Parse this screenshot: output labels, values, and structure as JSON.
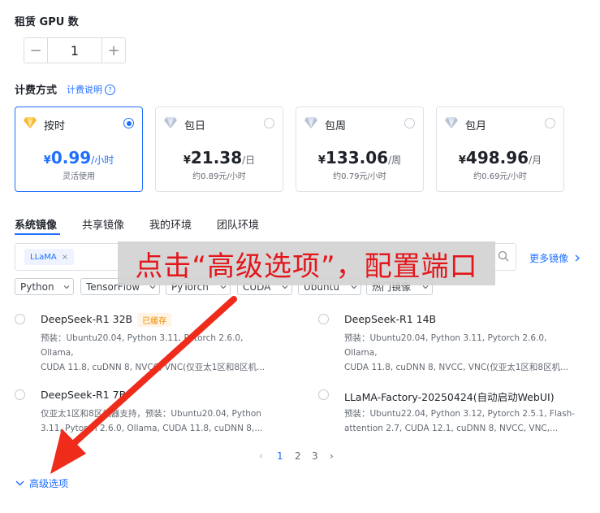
{
  "gpu": {
    "title": "租赁 GPU 数",
    "value": "1",
    "minus": "−",
    "plus": "+"
  },
  "billing": {
    "title": "计费方式",
    "help_link": "计费说明",
    "help_icon": "?",
    "plans": [
      {
        "name": "按时",
        "currency": "¥",
        "amount": "0.99",
        "unit": "/小时",
        "sub": "灵活使用",
        "selected": true,
        "icon": "gold-diamond-icon"
      },
      {
        "name": "包日",
        "currency": "¥",
        "amount": "21.38",
        "unit": "/日",
        "sub": "约0.89元/小时",
        "selected": false,
        "icon": "silver-diamond-icon"
      },
      {
        "name": "包周",
        "currency": "¥",
        "amount": "133.06",
        "unit": "/周",
        "sub": "约0.79元/小时",
        "selected": false,
        "icon": "silver-diamond-icon"
      },
      {
        "name": "包月",
        "currency": "¥",
        "amount": "498.96",
        "unit": "/月",
        "sub": "约0.69元/小时",
        "selected": false,
        "icon": "silver-diamond-icon"
      }
    ]
  },
  "tabs": [
    "系统镜像",
    "共享镜像",
    "我的环境",
    "团队环境"
  ],
  "search": {
    "chip": "LLaMA",
    "chip_close": "×",
    "more": "更多镜像"
  },
  "filters": [
    "Python",
    "TensorFlow",
    "PyTorch",
    "CUDA",
    "Ubuntu",
    "热门镜像"
  ],
  "images": [
    {
      "title": "DeepSeek-R1 32B",
      "badge": "已缓存",
      "desc1": "预装：Ubuntu20.04, Python 3.11, Pytorch 2.6.0, Ollama,",
      "desc2": "CUDA 11.8, cuDNN 8, NVCC, VNC(仅亚太1区和8区机..."
    },
    {
      "title": "DeepSeek-R1 14B",
      "badge": "",
      "desc1": "预装：Ubuntu20.04, Python 3.11, Pytorch 2.6.0, Ollama,",
      "desc2": "CUDA 11.8, cuDNN 8, NVCC, VNC(仅亚太1区和8区机..."
    },
    {
      "title": "DeepSeek-R1 7B",
      "badge": "",
      "desc1": "仅亚太1区和8区机器支持，预装：Ubuntu20.04, Python",
      "desc2": "3.11, Pytorch 2.6.0, Ollama, CUDA 11.8, cuDNN 8,..."
    },
    {
      "title": "LLaMA-Factory-20250424(自动启动WebUI)",
      "badge": "",
      "desc1": "预装：Ubuntu22.04, Python 3.12, Pytorch 2.5.1, Flash-",
      "desc2": "attention 2.7, CUDA 12.1, cuDNN 8, NVCC, VNC,..."
    }
  ],
  "pagination": {
    "prev": "‹",
    "pages": [
      "1",
      "2",
      "3"
    ],
    "next": "›",
    "current": "1"
  },
  "advanced": "高级选项",
  "annotation": "点击“高级选项”，配置端口",
  "colors": {
    "accent": "#1f6fff",
    "annotation": "#e3161b",
    "badge": "#f08c00"
  }
}
